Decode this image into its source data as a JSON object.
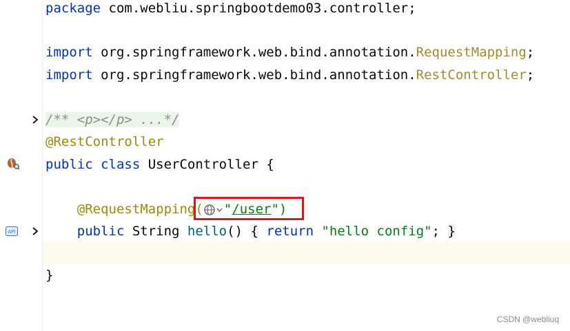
{
  "code": {
    "package_kw": "package",
    "package_name": " com.webliu.springbootdemo03.controller;",
    "import_kw": "import",
    "import1_path": " org.springframework.web.bind.annotation.",
    "import1_class": "RequestMapping",
    "import2_path": " org.springframework.web.bind.annotation.",
    "import2_class": "RestController",
    "semicolon": ";",
    "doc_comment": "/** <p></p> ...*/",
    "rest_controller_anno": "@RestController",
    "public_kw": "public",
    "class_kw": "class",
    "class_name": " UserController ",
    "open_brace": "{",
    "request_mapping_anno": "@RequestMapping(",
    "url_quote_open": "\"",
    "url_text": "/user",
    "url_quote_close": "\")",
    "string_type": " String ",
    "method_name": "hello",
    "method_parens": "()",
    "return_kw": "return",
    "return_value": "\"hello config\"",
    "close_brace": "}"
  },
  "gutter_icons": [
    "fold-expand-icon",
    "spring-bean-icon",
    "api-endpoint-icon",
    "fold-expand-icon"
  ],
  "watermark": "CSDN @webliuq",
  "colors": {
    "keyword": "#0033b3",
    "annotation": "#9e880d",
    "string": "#067d17",
    "highlight": "#e0141a"
  }
}
